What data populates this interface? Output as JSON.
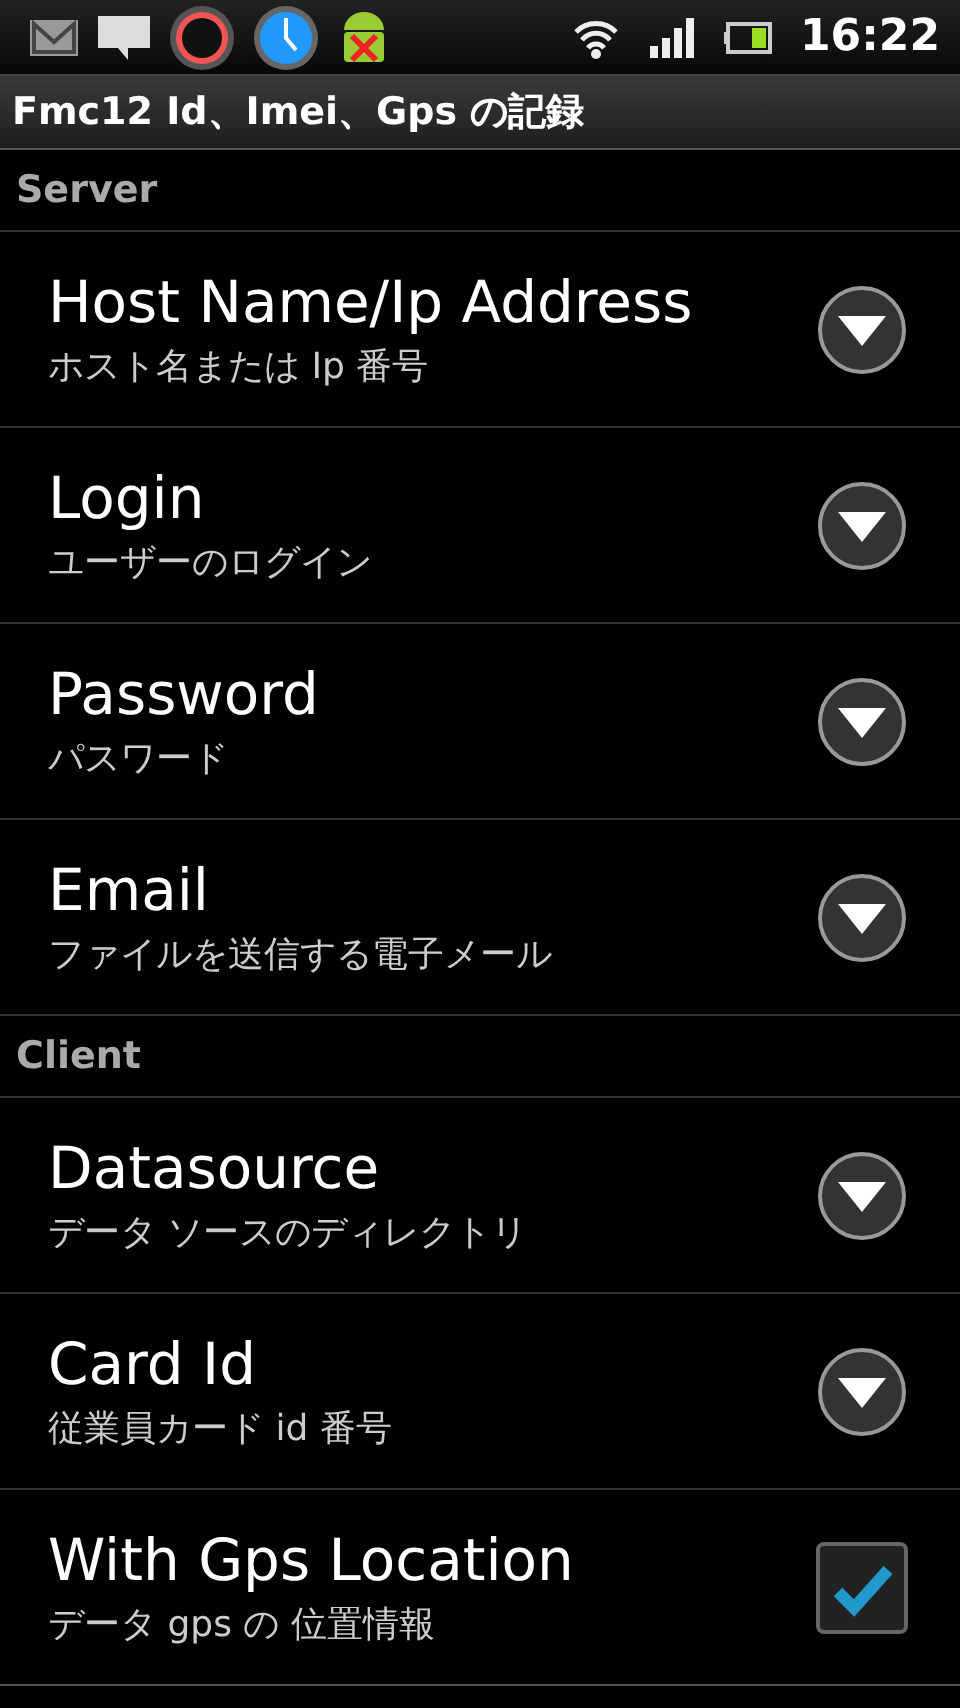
{
  "status_bar": {
    "time": "16:22"
  },
  "title": "Fmc12 Id、Imei、Gps の記録",
  "sections": [
    {
      "header": "Server",
      "items": [
        {
          "kind": "dropdown",
          "title": "Host Name/Ip Address",
          "summary": "ホスト名または Ip 番号"
        },
        {
          "kind": "dropdown",
          "title": "Login",
          "summary": "ユーザーのログイン"
        },
        {
          "kind": "dropdown",
          "title": "Password",
          "summary": "パスワード"
        },
        {
          "kind": "dropdown",
          "title": "Email",
          "summary": "ファイルを送信する電子メール"
        }
      ]
    },
    {
      "header": "Client",
      "items": [
        {
          "kind": "dropdown",
          "title": "Datasource",
          "summary": "データ ソースのディレクトリ"
        },
        {
          "kind": "dropdown",
          "title": "Card Id",
          "summary": "従業員カード id 番号"
        },
        {
          "kind": "checkbox",
          "title": "With Gps Location",
          "summary": "データ gps の 位置情報",
          "checked": true
        }
      ]
    }
  ]
}
